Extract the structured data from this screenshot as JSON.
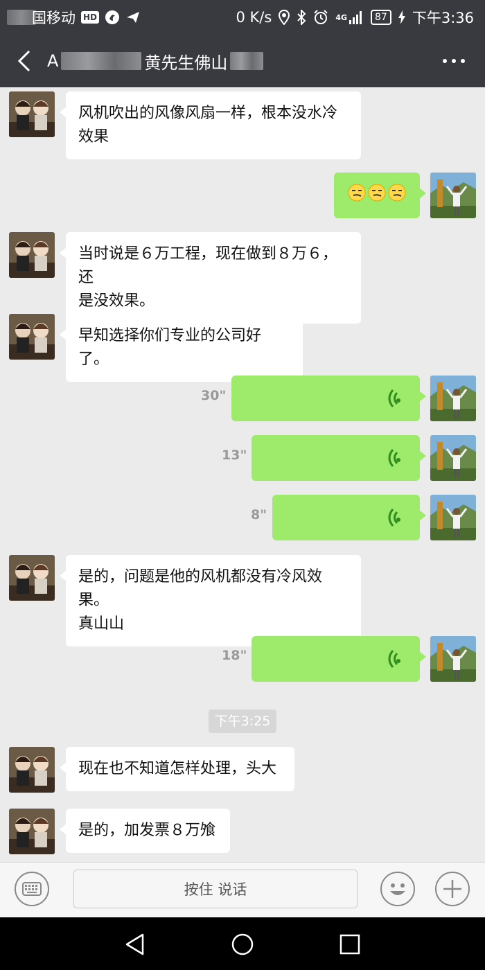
{
  "status": {
    "carrier": "国移动",
    "hd": "HD",
    "speed": "0 K/s",
    "network": "4G",
    "battery": "87",
    "time": "下午3:36"
  },
  "header": {
    "title_prefix": "A",
    "title_name": "黄先生佛山"
  },
  "messages": [
    {
      "side": "left",
      "text_lines": [
        "风机吹出的风像风扇一样，根本没水冷",
        "效果"
      ]
    },
    {
      "side": "right",
      "type": "emoji",
      "emoji_icons": [
        "smirk-face-icon",
        "smirk-face-icon",
        "smirk-face-icon"
      ]
    },
    {
      "side": "left",
      "text_lines": [
        "当时说是６万工程，现在做到８万６，还",
        "是没效果。"
      ]
    },
    {
      "side": "left",
      "text_lines": [
        "早知选择你们专业的公司好了。"
      ]
    },
    {
      "side": "right",
      "type": "voice",
      "duration": "30\""
    },
    {
      "side": "right",
      "type": "voice",
      "duration": "13\""
    },
    {
      "side": "right",
      "type": "voice",
      "duration": "8\""
    },
    {
      "side": "left",
      "text_lines": [
        "是的，问题是他的风机都没有冷风效果。",
        "真山山"
      ]
    },
    {
      "side": "right",
      "type": "voice",
      "duration": "18\""
    },
    {
      "type": "time",
      "text": "下午3:25"
    },
    {
      "side": "left",
      "text_lines": [
        "现在也不知道怎样处理，头大"
      ]
    },
    {
      "side": "left",
      "text_lines": [
        "是的，加发票８万飧"
      ]
    }
  ],
  "input": {
    "hold_to_talk": "按住 说话"
  },
  "colors": {
    "bar_bg": "#393a3f",
    "chat_bg": "#ebebeb",
    "right_bubble": "#9eea6a",
    "left_bubble": "#ffffff",
    "voice_wave": "#2f8d1f"
  }
}
